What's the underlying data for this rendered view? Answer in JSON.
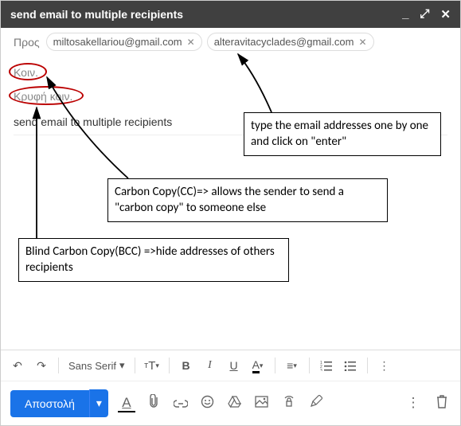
{
  "titlebar": {
    "title": "send email to multiple recipients"
  },
  "to": {
    "label": "Προς",
    "chips": [
      {
        "email": "miltosakellariou@gmail.com"
      },
      {
        "email": "alteravitacyclades@gmail.com"
      }
    ]
  },
  "cc": {
    "label": "Κοιν."
  },
  "bcc": {
    "label": "Κρυφή κοιν."
  },
  "subject": {
    "value": "send email to multiple recipients"
  },
  "annotations": {
    "typeEmails": "type the email addresses one by one and click on \"enter\"",
    "ccExplain": "Carbon Copy(CC)=> allows the sender to send a \"carbon copy\" to someone else",
    "bccExplain": "Blind Carbon Copy(BCC) =>hide addresses of others recipients"
  },
  "formatToolbar": {
    "undo": "↶",
    "redo": "↷",
    "fontName": "Sans Serif",
    "fontSizeIcon": "тT",
    "bold": "B",
    "italic": "I",
    "underline": "U",
    "textColor": "A"
  },
  "actionBar": {
    "sendLabel": "Αποστολή",
    "formatIcon": "A"
  }
}
